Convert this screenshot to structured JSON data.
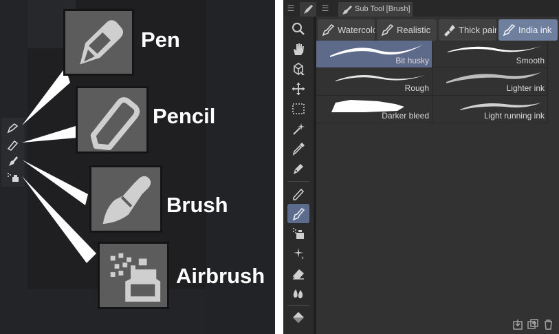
{
  "left": {
    "tools": [
      {
        "label": "Pen",
        "icon": "pen-icon"
      },
      {
        "label": "Pencil",
        "icon": "pencil-icon"
      },
      {
        "label": "Brush",
        "icon": "brush-icon"
      },
      {
        "label": "Airbrush",
        "icon": "airbrush-icon"
      }
    ]
  },
  "panel": {
    "tab_title": "Sub Tool [Brush]",
    "groups": [
      {
        "label": "Watercolor",
        "icon": "watercolor-brush-icon"
      },
      {
        "label": "Realistic",
        "icon": "realistic-brush-icon"
      },
      {
        "label": "Thick paint",
        "icon": "thick-paint-icon"
      },
      {
        "label": "India ink",
        "icon": "india-ink-icon",
        "active": true
      }
    ],
    "brushes": [
      {
        "label": "Bit husky",
        "selected": true
      },
      {
        "label": "Smooth"
      },
      {
        "label": "Rough"
      },
      {
        "label": "Lighter ink"
      },
      {
        "label": "Darker bleed"
      },
      {
        "label": "Light running ink"
      }
    ],
    "toolbar_icons": [
      "zoom-icon",
      "hand-icon",
      "rotate-icon",
      "move-icon",
      "selection-icon",
      "auto-select-icon",
      "eyedropper-icon",
      "pen-icon",
      "pencil-icon",
      "brush-icon",
      "airbrush-icon",
      "decoration-icon",
      "eraser-icon",
      "blend-icon",
      "fill-icon"
    ],
    "footer_icons": [
      "copy-to-icon",
      "duplicate-icon",
      "delete-icon"
    ]
  },
  "colors": {
    "accent": "#6f809e",
    "selected": "#5d6a8a"
  }
}
